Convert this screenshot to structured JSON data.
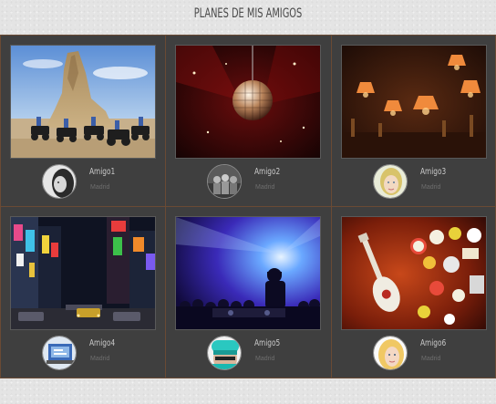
{
  "page": {
    "title": "PLANES DE MIS AMIGOS"
  },
  "friends": [
    {
      "name": "Amigo1",
      "city": "Madrid",
      "photo": "desert-rock-atv-photo",
      "avatar": "grayscale-portrait-avatar"
    },
    {
      "name": "Amigo2",
      "city": "Madrid",
      "photo": "disco-ball-club-photo",
      "avatar": "group-photo-avatar"
    },
    {
      "name": "Amigo3",
      "city": "Madrid",
      "photo": "lamp-bar-interior-photo",
      "avatar": "blonde-girl-avatar"
    },
    {
      "name": "Amigo4",
      "city": "Madrid",
      "photo": "city-night-street-photo",
      "avatar": "laptop-screen-avatar"
    },
    {
      "name": "Amigo5",
      "city": "Madrid",
      "photo": "dj-concert-crowd-photo",
      "avatar": "cyan-hat-avatar"
    },
    {
      "name": "Amigo6",
      "city": "Madrid",
      "photo": "guitar-sign-wall-photo",
      "avatar": "blonde-woman-avatar"
    }
  ],
  "colors": {
    "background": "#e4e4e4",
    "card": "#3f3f3f",
    "card_border": "#6a4a34",
    "title": "#4a4a4a",
    "name": "#c9c9c9",
    "city": "#6e6e6e"
  }
}
